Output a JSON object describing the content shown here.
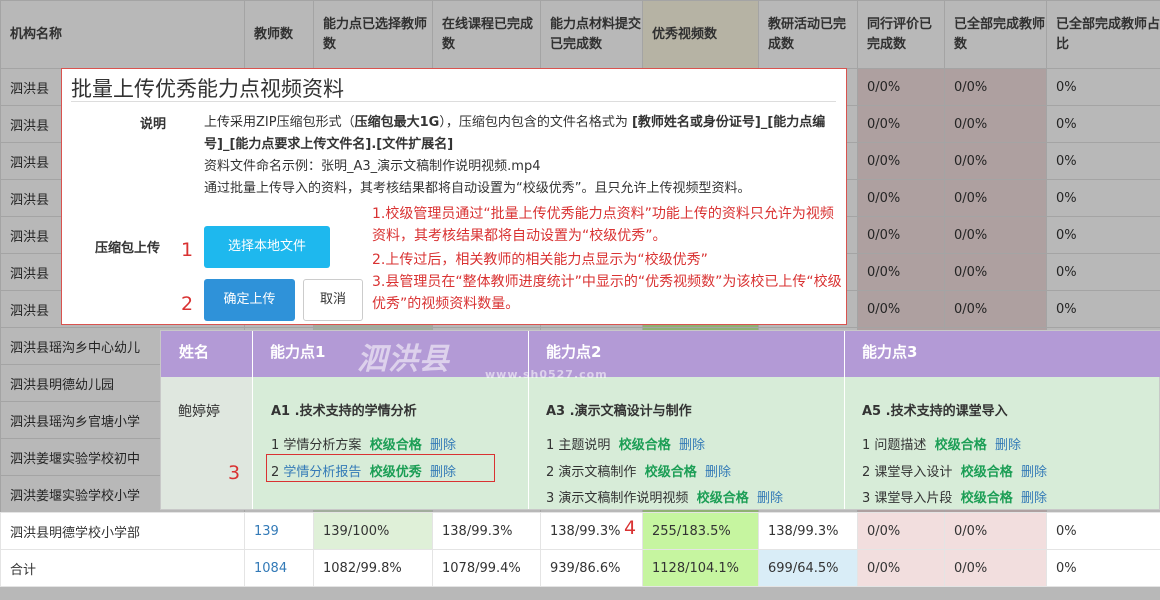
{
  "table": {
    "headers": [
      "机构名称",
      "教师数",
      "能力点已选择教师数",
      "在线课程已完成数",
      "能力点材料提交已完成数",
      "优秀视频数",
      "教研活动已完成数",
      "同行评价已完成数",
      "已全部完成教师数",
      "已全部完成教师占比"
    ],
    "rows": [
      [
        "泗洪县",
        "",
        "",
        "",
        "",
        "",
        "",
        "0/0%",
        "0/0%",
        "0%"
      ],
      [
        "泗洪县",
        "",
        "",
        "",
        "",
        "",
        "",
        "0/0%",
        "0/0%",
        "0%"
      ],
      [
        "泗洪县",
        "",
        "",
        "",
        "",
        "",
        "",
        "0/0%",
        "0/0%",
        "0%"
      ],
      [
        "泗洪县",
        "",
        "",
        "",
        "",
        "",
        "",
        "0/0%",
        "0/0%",
        "0%"
      ],
      [
        "泗洪县",
        "",
        "",
        "",
        "",
        "",
        "",
        "0/0%",
        "0/0%",
        "0%"
      ],
      [
        "泗洪县",
        "",
        "",
        "",
        "",
        "",
        "",
        "0/0%",
        "0/0%",
        "0%"
      ],
      [
        "泗洪县",
        "",
        "",
        "",
        "",
        "",
        "",
        "0/0%",
        "0/0%",
        "0%"
      ],
      [
        "泗洪县瑶沟乡中心幼儿",
        "",
        "",
        "",
        "",
        "",
        "",
        "",
        "",
        ""
      ],
      [
        "泗洪县明德幼儿园",
        "",
        "",
        "",
        "",
        "",
        "",
        "",
        "",
        ""
      ],
      [
        "泗洪县瑶沟乡官塘小学",
        "",
        "",
        "",
        "",
        "",
        "",
        "",
        "",
        ""
      ],
      [
        "泗洪姜堰实验学校初中",
        "",
        "",
        "",
        "",
        "",
        "",
        "",
        "",
        ""
      ],
      [
        "泗洪姜堰实验学校小学",
        "",
        "",
        "",
        "",
        "",
        "",
        "",
        "",
        ""
      ]
    ],
    "bottom_rows": [
      [
        "泗洪县明德学校小学部",
        "139",
        "139/100%",
        "138/99.3%",
        "138/99.3%",
        "255/183.5%",
        "138/99.3%",
        "0/0%",
        "0/0%",
        "0%"
      ],
      [
        "合计",
        "1084",
        "1082/99.8%",
        "1078/99.4%",
        "939/86.6%",
        "1128/104.1%",
        "699/64.5%",
        "0/0%",
        "0/0%",
        "0%"
      ]
    ]
  },
  "modal": {
    "title": "批量上传优秀能力点视频资料",
    "desc_label": "说明",
    "desc_line1a": "上传采用ZIP压缩包形式（",
    "desc_line1b": "压缩包最大1G",
    "desc_line1c": "），压缩包内包含的文件名格式为 ",
    "desc_line1d": "[教师姓名或身份证号]_[能力点编号]_[能力点要求上传文件名].[文件扩展名]",
    "desc_line2": "资料文件命名示例：张明_A3_演示文稿制作说明视频.mp4",
    "desc_line3": "通过批量上传导入的资料，其考核结果都将自动设置为“校级优秀”。且只允许上传视频型资料。",
    "upload_label": "压缩包上传",
    "choose_btn": "选择本地文件",
    "confirm_btn": "确定上传",
    "cancel_btn": "取消"
  },
  "annotations": {
    "n1": "1",
    "n2": "2",
    "n3": "3",
    "n4": "4",
    "note1": "1.校级管理员通过“批量上传优秀能力点资料”功能上传的资料只允许为视频资料，其考核结果都将自动设置为“校级优秀”。",
    "note2": "2.上传过后，相关教师的相关能力点显示为“校级优秀”",
    "note3": "3.县管理员在“整体教师进度统计”中显示的“优秀视频数”为该校已上传“校级优秀”的视频资料数量。"
  },
  "detail": {
    "h_name": "姓名",
    "h_c1": "能力点1",
    "h_c2": "能力点2",
    "h_c3": "能力点3",
    "teacher": "鲍婷婷",
    "c1_title": "A1 .技术支持的学情分析",
    "c1_items": [
      {
        "num": "1",
        "name": "学情分析方案",
        "status": "校级合格",
        "del": "删除"
      },
      {
        "num": "2",
        "name": "学情分析报告",
        "status": "校级优秀",
        "del": "删除"
      }
    ],
    "c2_title": "A3 .演示文稿设计与制作",
    "c2_items": [
      {
        "num": "1",
        "name": "主题说明",
        "status": "校级合格",
        "del": "删除"
      },
      {
        "num": "2",
        "name": "演示文稿制作",
        "status": "校级合格",
        "del": "删除"
      },
      {
        "num": "3",
        "name": "演示文稿制作说明视频",
        "status": "校级合格",
        "del": "删除"
      }
    ],
    "c3_title": "A5 .技术支持的课堂导入",
    "c3_items": [
      {
        "num": "1",
        "name": "问题描述",
        "status": "校级合格",
        "del": "删除"
      },
      {
        "num": "2",
        "name": "课堂导入设计",
        "status": "校级合格",
        "del": "删除"
      },
      {
        "num": "3",
        "name": "课堂导入片段",
        "status": "校级合格",
        "del": "删除"
      }
    ],
    "watermark": "泗洪县",
    "watermark_url": "www.sh0527.com"
  }
}
